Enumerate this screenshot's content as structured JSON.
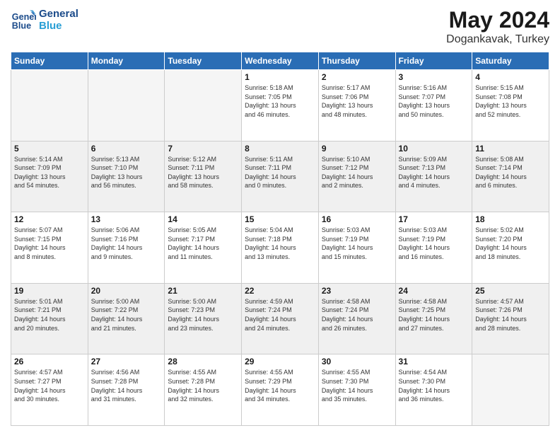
{
  "header": {
    "logo_line1": "General",
    "logo_line2": "Blue",
    "title": "May 2024",
    "subtitle": "Dogankavak, Turkey"
  },
  "weekdays": [
    "Sunday",
    "Monday",
    "Tuesday",
    "Wednesday",
    "Thursday",
    "Friday",
    "Saturday"
  ],
  "weeks": [
    [
      {
        "day": "",
        "info": ""
      },
      {
        "day": "",
        "info": ""
      },
      {
        "day": "",
        "info": ""
      },
      {
        "day": "1",
        "info": "Sunrise: 5:18 AM\nSunset: 7:05 PM\nDaylight: 13 hours\nand 46 minutes."
      },
      {
        "day": "2",
        "info": "Sunrise: 5:17 AM\nSunset: 7:06 PM\nDaylight: 13 hours\nand 48 minutes."
      },
      {
        "day": "3",
        "info": "Sunrise: 5:16 AM\nSunset: 7:07 PM\nDaylight: 13 hours\nand 50 minutes."
      },
      {
        "day": "4",
        "info": "Sunrise: 5:15 AM\nSunset: 7:08 PM\nDaylight: 13 hours\nand 52 minutes."
      }
    ],
    [
      {
        "day": "5",
        "info": "Sunrise: 5:14 AM\nSunset: 7:09 PM\nDaylight: 13 hours\nand 54 minutes."
      },
      {
        "day": "6",
        "info": "Sunrise: 5:13 AM\nSunset: 7:10 PM\nDaylight: 13 hours\nand 56 minutes."
      },
      {
        "day": "7",
        "info": "Sunrise: 5:12 AM\nSunset: 7:11 PM\nDaylight: 13 hours\nand 58 minutes."
      },
      {
        "day": "8",
        "info": "Sunrise: 5:11 AM\nSunset: 7:11 PM\nDaylight: 14 hours\nand 0 minutes."
      },
      {
        "day": "9",
        "info": "Sunrise: 5:10 AM\nSunset: 7:12 PM\nDaylight: 14 hours\nand 2 minutes."
      },
      {
        "day": "10",
        "info": "Sunrise: 5:09 AM\nSunset: 7:13 PM\nDaylight: 14 hours\nand 4 minutes."
      },
      {
        "day": "11",
        "info": "Sunrise: 5:08 AM\nSunset: 7:14 PM\nDaylight: 14 hours\nand 6 minutes."
      }
    ],
    [
      {
        "day": "12",
        "info": "Sunrise: 5:07 AM\nSunset: 7:15 PM\nDaylight: 14 hours\nand 8 minutes."
      },
      {
        "day": "13",
        "info": "Sunrise: 5:06 AM\nSunset: 7:16 PM\nDaylight: 14 hours\nand 9 minutes."
      },
      {
        "day": "14",
        "info": "Sunrise: 5:05 AM\nSunset: 7:17 PM\nDaylight: 14 hours\nand 11 minutes."
      },
      {
        "day": "15",
        "info": "Sunrise: 5:04 AM\nSunset: 7:18 PM\nDaylight: 14 hours\nand 13 minutes."
      },
      {
        "day": "16",
        "info": "Sunrise: 5:03 AM\nSunset: 7:19 PM\nDaylight: 14 hours\nand 15 minutes."
      },
      {
        "day": "17",
        "info": "Sunrise: 5:03 AM\nSunset: 7:19 PM\nDaylight: 14 hours\nand 16 minutes."
      },
      {
        "day": "18",
        "info": "Sunrise: 5:02 AM\nSunset: 7:20 PM\nDaylight: 14 hours\nand 18 minutes."
      }
    ],
    [
      {
        "day": "19",
        "info": "Sunrise: 5:01 AM\nSunset: 7:21 PM\nDaylight: 14 hours\nand 20 minutes."
      },
      {
        "day": "20",
        "info": "Sunrise: 5:00 AM\nSunset: 7:22 PM\nDaylight: 14 hours\nand 21 minutes."
      },
      {
        "day": "21",
        "info": "Sunrise: 5:00 AM\nSunset: 7:23 PM\nDaylight: 14 hours\nand 23 minutes."
      },
      {
        "day": "22",
        "info": "Sunrise: 4:59 AM\nSunset: 7:24 PM\nDaylight: 14 hours\nand 24 minutes."
      },
      {
        "day": "23",
        "info": "Sunrise: 4:58 AM\nSunset: 7:24 PM\nDaylight: 14 hours\nand 26 minutes."
      },
      {
        "day": "24",
        "info": "Sunrise: 4:58 AM\nSunset: 7:25 PM\nDaylight: 14 hours\nand 27 minutes."
      },
      {
        "day": "25",
        "info": "Sunrise: 4:57 AM\nSunset: 7:26 PM\nDaylight: 14 hours\nand 28 minutes."
      }
    ],
    [
      {
        "day": "26",
        "info": "Sunrise: 4:57 AM\nSunset: 7:27 PM\nDaylight: 14 hours\nand 30 minutes."
      },
      {
        "day": "27",
        "info": "Sunrise: 4:56 AM\nSunset: 7:28 PM\nDaylight: 14 hours\nand 31 minutes."
      },
      {
        "day": "28",
        "info": "Sunrise: 4:55 AM\nSunset: 7:28 PM\nDaylight: 14 hours\nand 32 minutes."
      },
      {
        "day": "29",
        "info": "Sunrise: 4:55 AM\nSunset: 7:29 PM\nDaylight: 14 hours\nand 34 minutes."
      },
      {
        "day": "30",
        "info": "Sunrise: 4:55 AM\nSunset: 7:30 PM\nDaylight: 14 hours\nand 35 minutes."
      },
      {
        "day": "31",
        "info": "Sunrise: 4:54 AM\nSunset: 7:30 PM\nDaylight: 14 hours\nand 36 minutes."
      },
      {
        "day": "",
        "info": ""
      }
    ]
  ]
}
